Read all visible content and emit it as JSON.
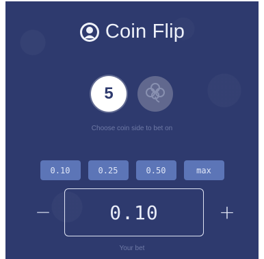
{
  "app": {
    "title": "Coin Flip",
    "logo_icon": "coin-face-icon"
  },
  "coins": {
    "side_a_label": "5",
    "side_b_icon": "clover-icon",
    "hint": "Choose coin side to bet on"
  },
  "presets": [
    "0.10",
    "0.25",
    "0.50",
    "max"
  ],
  "bet": {
    "value": "0.10",
    "decrement_label": "−",
    "increment_label": "+",
    "caption": "Your bet"
  },
  "colors": {
    "panel_bg": "#2e3a6e",
    "preset_bg": "#5c75b7",
    "text_light": "#eef1f9",
    "muted_text": "#6f7aa6"
  }
}
